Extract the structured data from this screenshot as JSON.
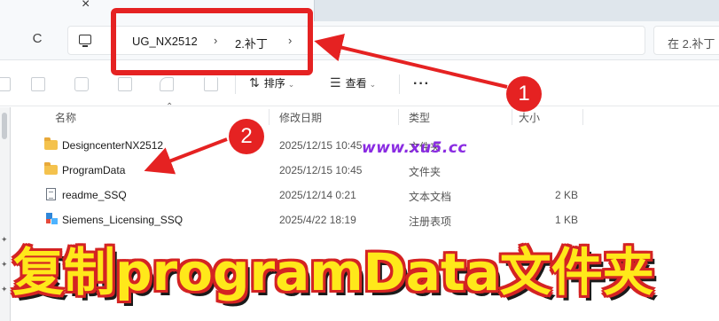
{
  "tab": {
    "close_glyph": "×"
  },
  "nav": {
    "refresh_glyph": "C"
  },
  "breadcrumb": [
    {
      "label": "UG_NX2512",
      "sep": "›"
    },
    {
      "label": "2.补丁",
      "sep": "›"
    }
  ],
  "search": {
    "placeholder": "在 2.补丁"
  },
  "toolbar": {
    "sort_label": "排序",
    "view_label": "查看",
    "more_glyph": "···",
    "icons": [
      "cut-icon",
      "copy-icon",
      "paste-icon",
      "rename-icon",
      "share-icon",
      "delete-icon"
    ]
  },
  "columns": {
    "name": "名称",
    "modified": "修改日期",
    "type": "类型",
    "size": "大小"
  },
  "files": [
    {
      "name": "DesigncenterNX2512",
      "modified": "2025/12/15 10:45",
      "type": "文件夹",
      "size": "",
      "icon": "folder-icon"
    },
    {
      "name": "ProgramData",
      "modified": "2025/12/15 10:45",
      "type": "文件夹",
      "size": "",
      "icon": "folder-icon"
    },
    {
      "name": "readme_SSQ",
      "modified": "2025/12/14 0:21",
      "type": "文本文档",
      "size": "2 KB",
      "icon": "text-file-icon"
    },
    {
      "name": "Siemens_Licensing_SSQ",
      "modified": "2025/4/22 18:19",
      "type": "注册表项",
      "size": "1 KB",
      "icon": "registry-file-icon"
    }
  ],
  "annotations": {
    "badge1": "1",
    "badge2": "2",
    "watermark": "www.xu5.cc",
    "caption": "复制programData文件夹",
    "color_red": "#e52222",
    "color_caption": "#ffe81a"
  }
}
